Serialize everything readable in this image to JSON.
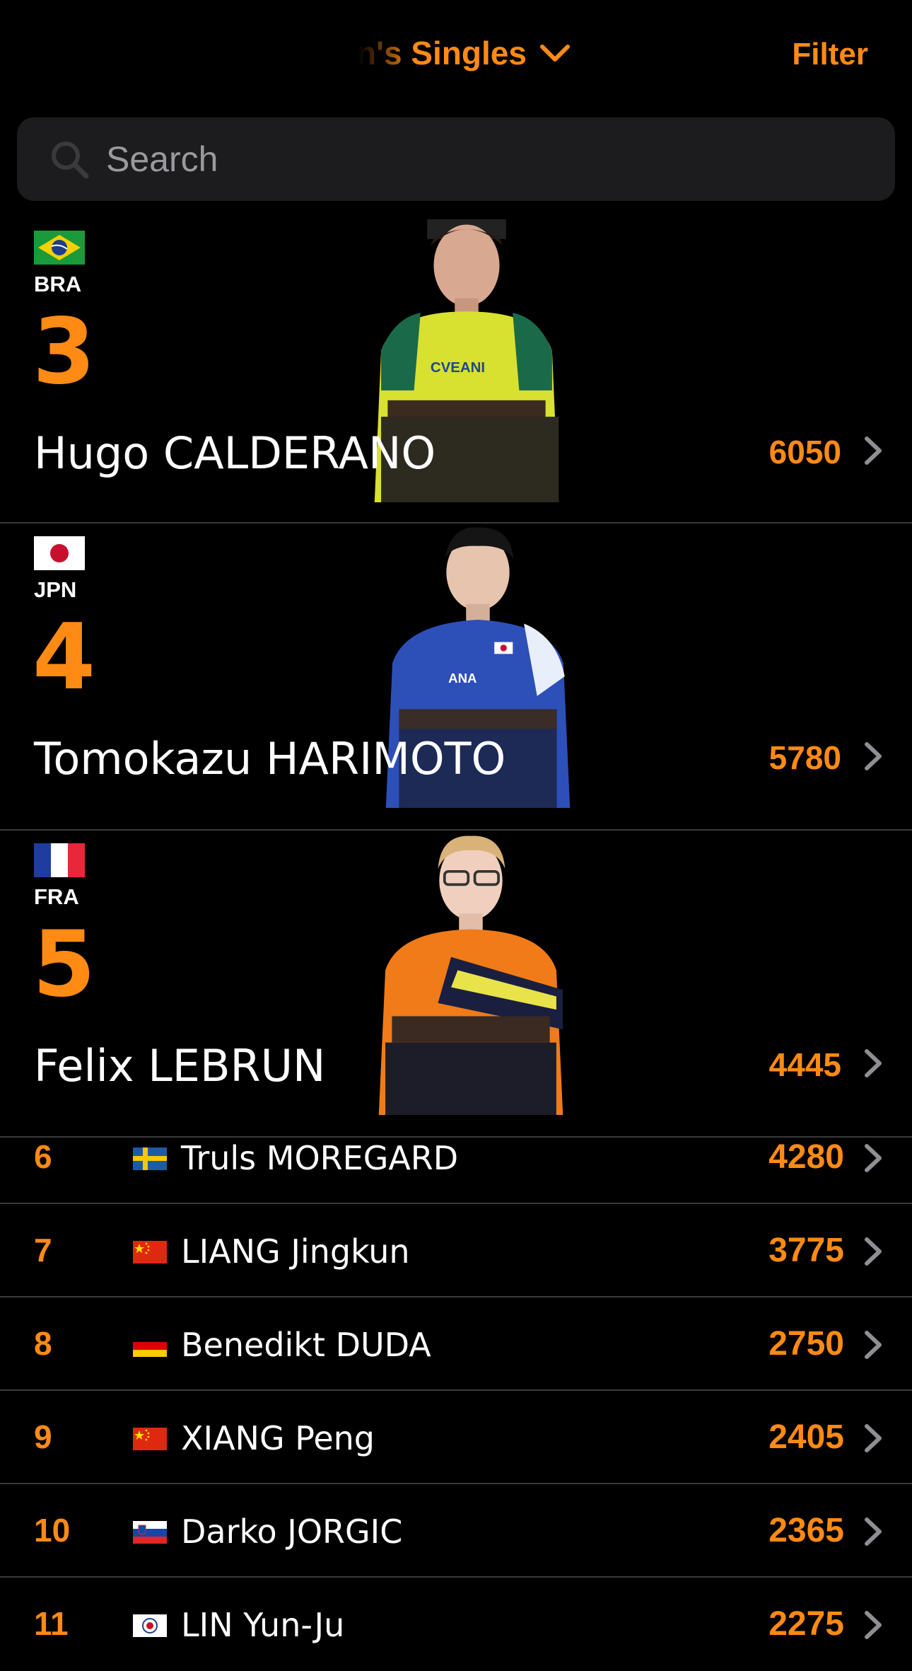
{
  "header": {
    "title": "Men's Singles",
    "filter_label": "Filter"
  },
  "search": {
    "placeholder": "Search"
  },
  "colors": {
    "accent": "#ff8a14",
    "background": "#000000",
    "search_bg": "#1c1c1e",
    "divider": "#3a3a3c"
  },
  "featured": [
    {
      "country": "BRA",
      "rank": "3",
      "name": "Hugo CALDERANO",
      "points": "6050",
      "flag": "brazil-flag"
    },
    {
      "country": "JPN",
      "rank": "4",
      "name": "Tomokazu HARIMOTO",
      "points": "5780",
      "flag": "japan-flag"
    },
    {
      "country": "FRA",
      "rank": "5",
      "name": "Felix LEBRUN",
      "points": "4445",
      "flag": "france-flag"
    }
  ],
  "rows": [
    {
      "rank": "6",
      "name": "Truls MOREGARD",
      "points": "4280",
      "flag": "sweden-flag"
    },
    {
      "rank": "7",
      "name": "LIANG Jingkun",
      "points": "3775",
      "flag": "china-flag"
    },
    {
      "rank": "8",
      "name": "Benedikt DUDA",
      "points": "2750",
      "flag": "germany-flag"
    },
    {
      "rank": "9",
      "name": "XIANG Peng",
      "points": "2405",
      "flag": "china-flag"
    },
    {
      "rank": "10",
      "name": "Darko JORGIC",
      "points": "2365",
      "flag": "slovenia-flag"
    },
    {
      "rank": "11",
      "name": "LIN Yun-Ju",
      "points": "2275",
      "flag": "chinese-taipei-flag"
    }
  ]
}
